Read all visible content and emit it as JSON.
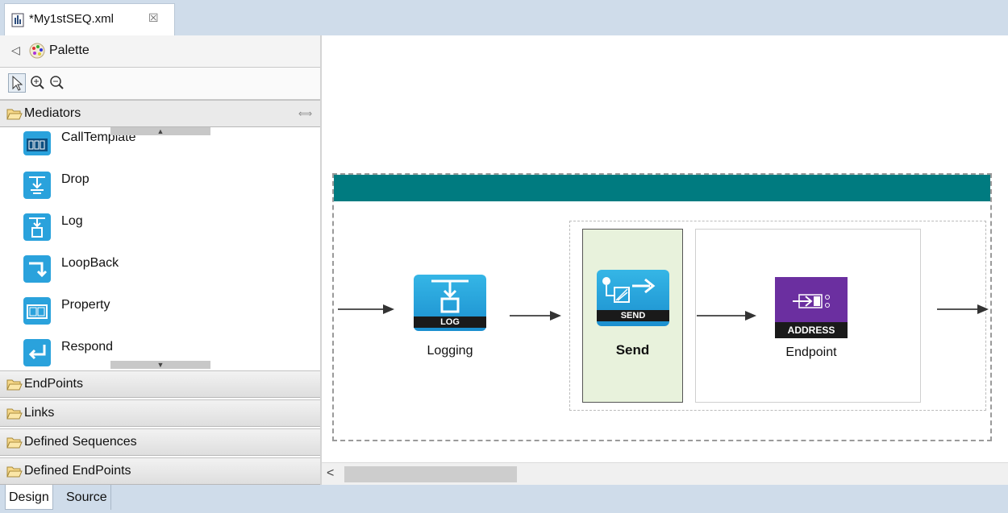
{
  "editor": {
    "tab_title": "*My1stSEQ.xml",
    "close_glyph": "☒"
  },
  "palette": {
    "collapse_glyph": "◁",
    "title": "Palette",
    "tools": [
      "select-tool",
      "zoom-in-tool",
      "zoom-out-tool"
    ],
    "drawers": {
      "mediators": "Mediators",
      "endpoints": "EndPoints",
      "links": "Links",
      "defined_sequences": "Defined Sequences",
      "defined_endpoints": "Defined EndPoints"
    },
    "mediator_items": [
      {
        "label": "CallTemplate",
        "icon": "calltemplate-icon"
      },
      {
        "label": "Drop",
        "icon": "drop-icon"
      },
      {
        "label": "Log",
        "icon": "log-icon"
      },
      {
        "label": "LoopBack",
        "icon": "loopback-icon"
      },
      {
        "label": "Property",
        "icon": "property-icon"
      },
      {
        "label": "Respond",
        "icon": "respond-icon"
      }
    ]
  },
  "canvas": {
    "nodes": {
      "log": {
        "badge": "LOG",
        "label": "Logging"
      },
      "send": {
        "badge": "SEND",
        "label": "Send"
      },
      "endpoint": {
        "badge": "ADDRESS",
        "label": "Endpoint"
      }
    },
    "scroll_left_glyph": "<"
  },
  "bottom_tabs": {
    "design": "Design",
    "source": "Source"
  },
  "colors": {
    "sequence_header": "#007b80",
    "send_cell": "#e8f2dc",
    "mediator_icon": "#2aa2dc",
    "address_icon": "#6b2fa0",
    "tab_bar": "#cfdcea"
  }
}
